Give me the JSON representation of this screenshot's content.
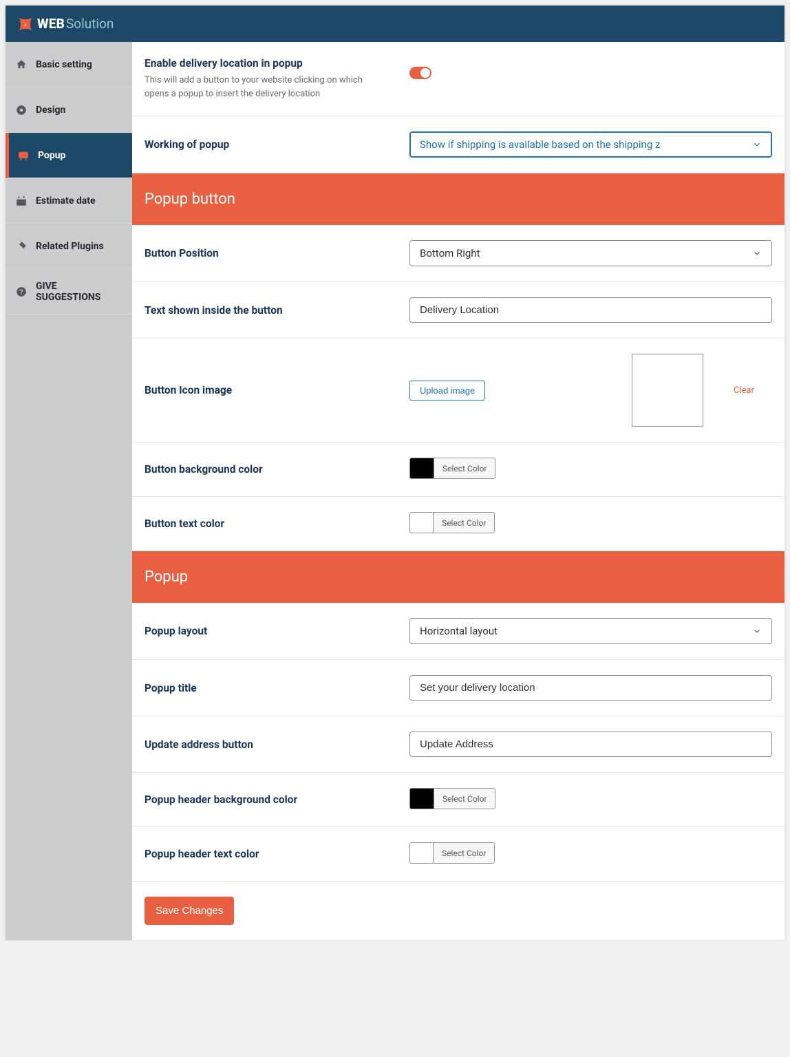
{
  "brand": {
    "web": "WEB",
    "solution": "Solution"
  },
  "sidebar": {
    "items": [
      {
        "label": "Basic setting"
      },
      {
        "label": "Design"
      },
      {
        "label": "Popup"
      },
      {
        "label": "Estimate date"
      },
      {
        "label": "Related Plugins"
      },
      {
        "label": "GIVE SUGGESTIONS"
      }
    ]
  },
  "enable": {
    "title": "Enable delivery location in popup",
    "desc": "This will add a button to your website clicking on which opens a popup to insert the delivery location"
  },
  "working": {
    "label": "Working of popup",
    "value": "Show if shipping is available based on the shipping z"
  },
  "groups": {
    "button": "Popup button",
    "popup": "Popup"
  },
  "btn_position": {
    "label": "Button Position",
    "value": "Bottom Right"
  },
  "btn_text": {
    "label": "Text shown inside the button",
    "value": "Delivery Location"
  },
  "btn_icon": {
    "label": "Button Icon image",
    "upload": "Upload image",
    "clear": "Clear"
  },
  "btn_bg": {
    "label": "Button background color",
    "select": "Select Color"
  },
  "btn_tx": {
    "label": "Button text color",
    "select": "Select Color"
  },
  "pop_layout": {
    "label": "Popup layout",
    "value": "Horizontal layout"
  },
  "pop_title": {
    "label": "Popup title",
    "value": "Set your delivery location"
  },
  "pop_update": {
    "label": "Update address button",
    "value": "Update Address"
  },
  "pop_hdr_bg": {
    "label": "Popup header background color",
    "select": "Select Color"
  },
  "pop_hdr_tx": {
    "label": "Popup header text color",
    "select": "Select Color"
  },
  "save": "Save Changes"
}
